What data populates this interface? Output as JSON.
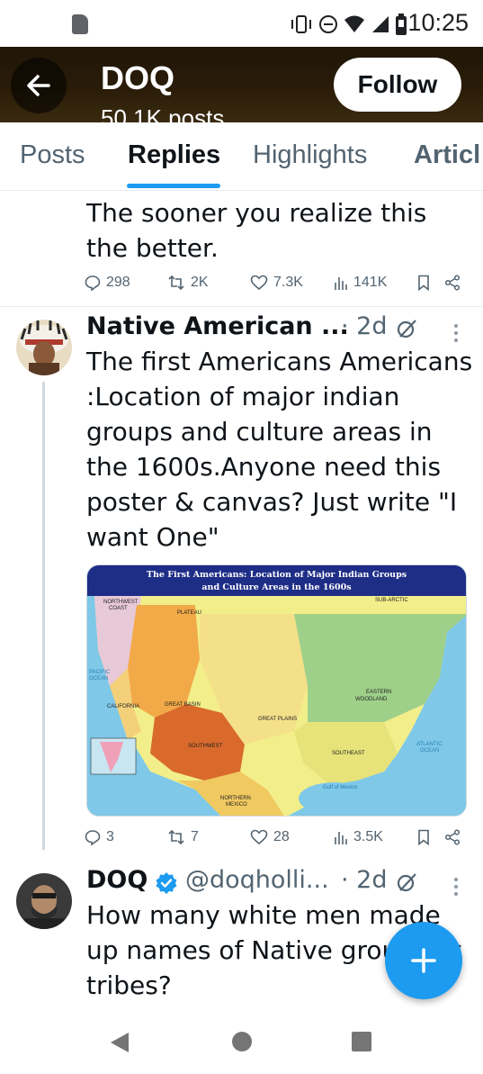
{
  "status_bar": {
    "time": "10:25"
  },
  "header": {
    "name": "DOQ",
    "subtitle": "50.1K posts",
    "follow_label": "Follow"
  },
  "tabs": [
    {
      "label": "Posts",
      "active": false
    },
    {
      "label": "Replies",
      "active": true
    },
    {
      "label": "Highlights",
      "active": false
    },
    {
      "label": "Articl",
      "active": false
    }
  ],
  "tweets": [
    {
      "text": "The sooner you realize this the better.",
      "stats": {
        "replies": "298",
        "reposts": "2K",
        "likes": "7.3K",
        "views": "141K"
      }
    },
    {
      "author": "Native American ...",
      "time": "2d",
      "text": "The first Americans Americans :Location of major indian  groups and culture areas in the 1600s.Anyone need this poster & canvas? Just write \"I want One\"",
      "image": {
        "title_line1": "The First Americans: Location of Major Indian Groups",
        "title_line2": "and Culture Areas in the 1600s",
        "area_labels": [
          "NORTHWEST COAST",
          "PLATEAU",
          "GREAT BASIN",
          "CALIFORNIA",
          "SOUTHWEST",
          "GREAT PLAINS",
          "WOODLAND",
          "EASTERN",
          "SOUTHEAST",
          "NORTHERN MEXICO",
          "SUB-ARCTIC",
          "PACIFIC OCEAN",
          "ATLANTIC OCEAN",
          "Gulf of Mexico"
        ]
      },
      "stats": {
        "replies": "3",
        "reposts": "7",
        "likes": "28",
        "views": "3.5K"
      }
    },
    {
      "author": "DOQ",
      "handle": "@doqholli...",
      "time": "2d",
      "text": "How many white men made up names of Native groups or tribes?"
    }
  ],
  "colors": {
    "accent": "#1d9bf0",
    "muted": "#536471",
    "text": "#0f1419"
  }
}
